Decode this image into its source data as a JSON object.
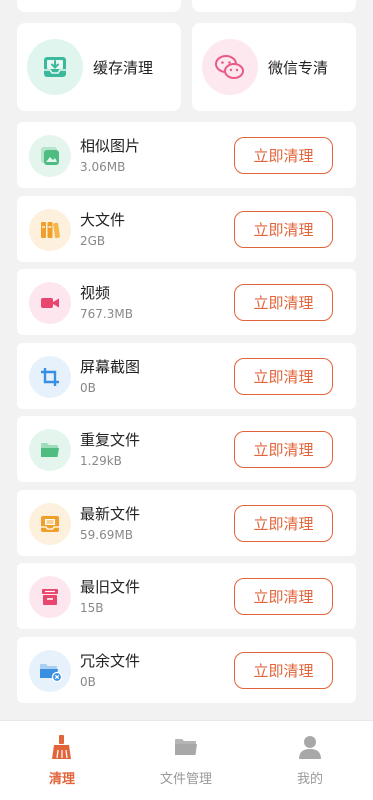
{
  "tiles": [
    {
      "label": "缓存清理",
      "icon": "inbox-download-icon"
    },
    {
      "label": "微信专清",
      "icon": "wechat-icon"
    }
  ],
  "rows": [
    {
      "title": "相似图片",
      "size": "3.06MB",
      "icon": "similar-photos-icon"
    },
    {
      "title": "大文件",
      "size": "2GB",
      "icon": "books-icon"
    },
    {
      "title": "视频",
      "size": "767.3MB",
      "icon": "video-camera-icon"
    },
    {
      "title": "屏幕截图",
      "size": "0B",
      "icon": "crop-icon"
    },
    {
      "title": "重复文件",
      "size": "1.29kB",
      "icon": "folder-icon"
    },
    {
      "title": "最新文件",
      "size": "59.69MB",
      "icon": "document-tray-icon"
    },
    {
      "title": "最旧文件",
      "size": "15B",
      "icon": "archive-box-icon"
    },
    {
      "title": "冗余文件",
      "size": "0B",
      "icon": "folder-remove-icon"
    }
  ],
  "clean_button_label": "立即清理",
  "nav": [
    {
      "label": "清理",
      "icon": "broom-icon",
      "active": true
    },
    {
      "label": "文件管理",
      "icon": "folder-icon",
      "active": false
    },
    {
      "label": "我的",
      "icon": "user-icon",
      "active": false
    }
  ],
  "colors": {
    "accent": "#e2643a",
    "background": "#f2f2f2"
  }
}
